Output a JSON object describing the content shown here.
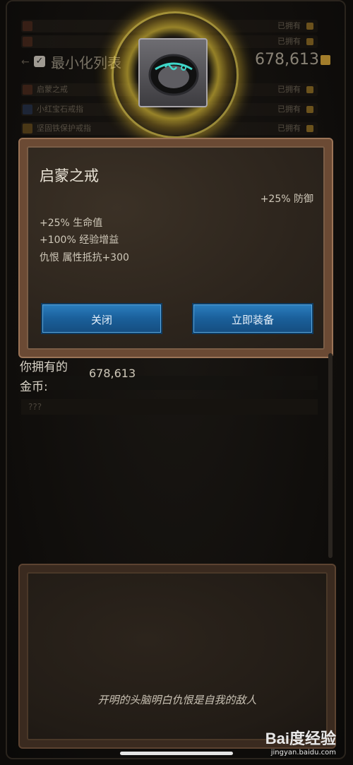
{
  "background_list": {
    "rows": [
      {
        "name": "",
        "status": "已拥有"
      },
      {
        "name": "",
        "status": "已拥有"
      },
      {
        "name": "启蒙之戒",
        "status": "已拥有"
      },
      {
        "name": "小红宝石戒指",
        "status": "已拥有"
      },
      {
        "name": "坚固铁保护戒指",
        "status": "已拥有"
      }
    ],
    "minimize_label": "最小化列表",
    "gold_total": "678,613"
  },
  "dialog": {
    "item_name": "启蒙之戒",
    "stat_right": "+25% 防御",
    "stats": [
      "+25% 生命值",
      "+100% 经验增益",
      "仇恨 属性抵抗+300"
    ],
    "close_label": "关闭",
    "equip_label": "立即装备"
  },
  "coins": {
    "label_line1": "你拥有的",
    "label_line2": "金币:",
    "value": "678,613",
    "mystery": "???"
  },
  "quote": {
    "text": "开明的头脑明白仇恨是自我的敌人"
  },
  "watermark": {
    "logo": "Bai度经验",
    "url": "jingyan.baidu.com"
  },
  "colors": {
    "button_blue": "#1a5f9a",
    "panel_brown": "#6b4a34",
    "glow_yellow": "#ffd23c",
    "ring_teal": "#3fd6c8"
  }
}
